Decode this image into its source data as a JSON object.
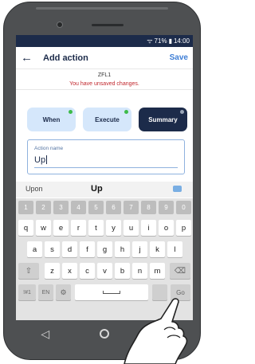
{
  "status_bar": {
    "signal": "ᯤ",
    "battery_pct": "71%",
    "time": "14:00"
  },
  "app_bar": {
    "back_glyph": "←",
    "title": "Add action",
    "save_label": "Save"
  },
  "device_label": "ZFL1",
  "warning": "You have unsaved changes.",
  "tabs": [
    {
      "label": "When",
      "status_color": "#3dbb4a"
    },
    {
      "label": "Execute",
      "status_color": "#3dbb4a"
    },
    {
      "label": "Summary",
      "status_color": "#9aa6b8"
    }
  ],
  "action_name": {
    "label": "Action name",
    "value": "Up"
  },
  "suggestions": {
    "left": "Upon",
    "middle": "Up"
  },
  "keyboard": {
    "numbers": [
      "1",
      "2",
      "3",
      "4",
      "5",
      "6",
      "7",
      "8",
      "9",
      "0"
    ],
    "row1": [
      "q",
      "w",
      "e",
      "r",
      "t",
      "y",
      "u",
      "i",
      "o",
      "p"
    ],
    "row2": [
      "a",
      "s",
      "d",
      "f",
      "g",
      "h",
      "j",
      "k",
      "l"
    ],
    "row3": [
      "z",
      "x",
      "c",
      "v",
      "b",
      "n",
      "m"
    ],
    "shift": "⇧",
    "backspace": "⌫",
    "symbols": "!#1",
    "lang": "EN",
    "settings": "⚙",
    "go": "Go"
  },
  "nav": {
    "back": "◁",
    "home": "home",
    "recent": "recent"
  },
  "colors": {
    "navy": "#1c2b4a",
    "accent_blue": "#3e7ed6",
    "warning_red": "#c1272d",
    "tab_light": "#d5e7fb"
  }
}
